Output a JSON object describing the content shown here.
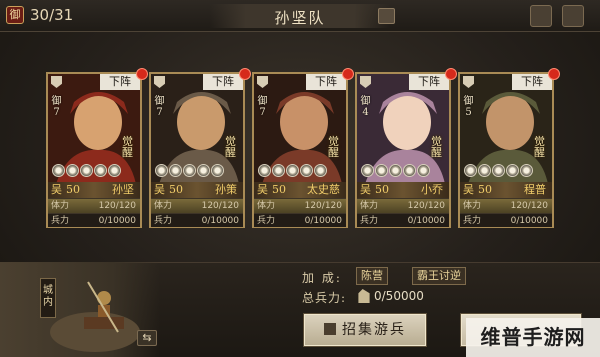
{
  "header": {
    "defense_badge": "御",
    "team_count": "30/31",
    "team_title": "孙坚队"
  },
  "icons": {
    "edit": "edit-icon",
    "settings": "gear-icon",
    "share": "share-icon"
  },
  "cards": [
    {
      "class_icon": "shield-icon",
      "defense": "御",
      "cost": "7",
      "unassign": "下阵",
      "awaken": "觉醒",
      "faction": "吴",
      "level": "50",
      "hero": "孙坚",
      "stamina_label": "体力",
      "stamina": "120/120",
      "stamina_fill": 1.0,
      "troops_label": "兵力",
      "troops": "0/10000"
    },
    {
      "class_icon": "spear-icon",
      "defense": "御",
      "cost": "7",
      "unassign": "下阵",
      "awaken": "觉醒",
      "faction": "吴",
      "level": "50",
      "hero": "孙策",
      "stamina_label": "体力",
      "stamina": "120/120",
      "stamina_fill": 1.0,
      "troops_label": "兵力",
      "troops": "0/10000"
    },
    {
      "class_icon": "crossed-swords-icon",
      "defense": "御",
      "cost": "7",
      "unassign": "下阵",
      "awaken": "觉醒",
      "faction": "吴",
      "level": "50",
      "hero": "太史慈",
      "stamina_label": "体力",
      "stamina": "120/120",
      "stamina_fill": 1.0,
      "troops_label": "兵力",
      "troops": "0/10000"
    },
    {
      "class_icon": "crossed-swords-icon",
      "defense": "御",
      "cost": "4",
      "unassign": "下阵",
      "awaken": "觉醒",
      "faction": "吴",
      "level": "50",
      "hero": "小乔",
      "stamina_label": "体力",
      "stamina": "120/120",
      "stamina_fill": 1.0,
      "troops_label": "兵力",
      "troops": "0/10000"
    },
    {
      "class_icon": "shield-icon",
      "defense": "御",
      "cost": "5",
      "unassign": "下阵",
      "awaken": "觉醒",
      "faction": "吴",
      "level": "50",
      "hero": "程普",
      "stamina_label": "体力",
      "stamina": "120/120",
      "stamina_fill": 1.0,
      "troops_label": "兵力",
      "troops": "0/10000"
    }
  ],
  "bottom": {
    "city_tag": "城内",
    "swap_icon": "swap-arrows-icon",
    "bonus_label": "加  成:",
    "bonus_tags": [
      "陈营",
      "霸王讨逆"
    ],
    "total_troops_label": "总兵力:",
    "total_troops": "0/50000",
    "recruit_button": "招集游兵"
  },
  "watermark": "维普手游网",
  "colors": {
    "card_border": "#a98b55",
    "name_gold": "#f1cd6a",
    "notify_red": "#d6291b",
    "background": "#1b1815"
  }
}
